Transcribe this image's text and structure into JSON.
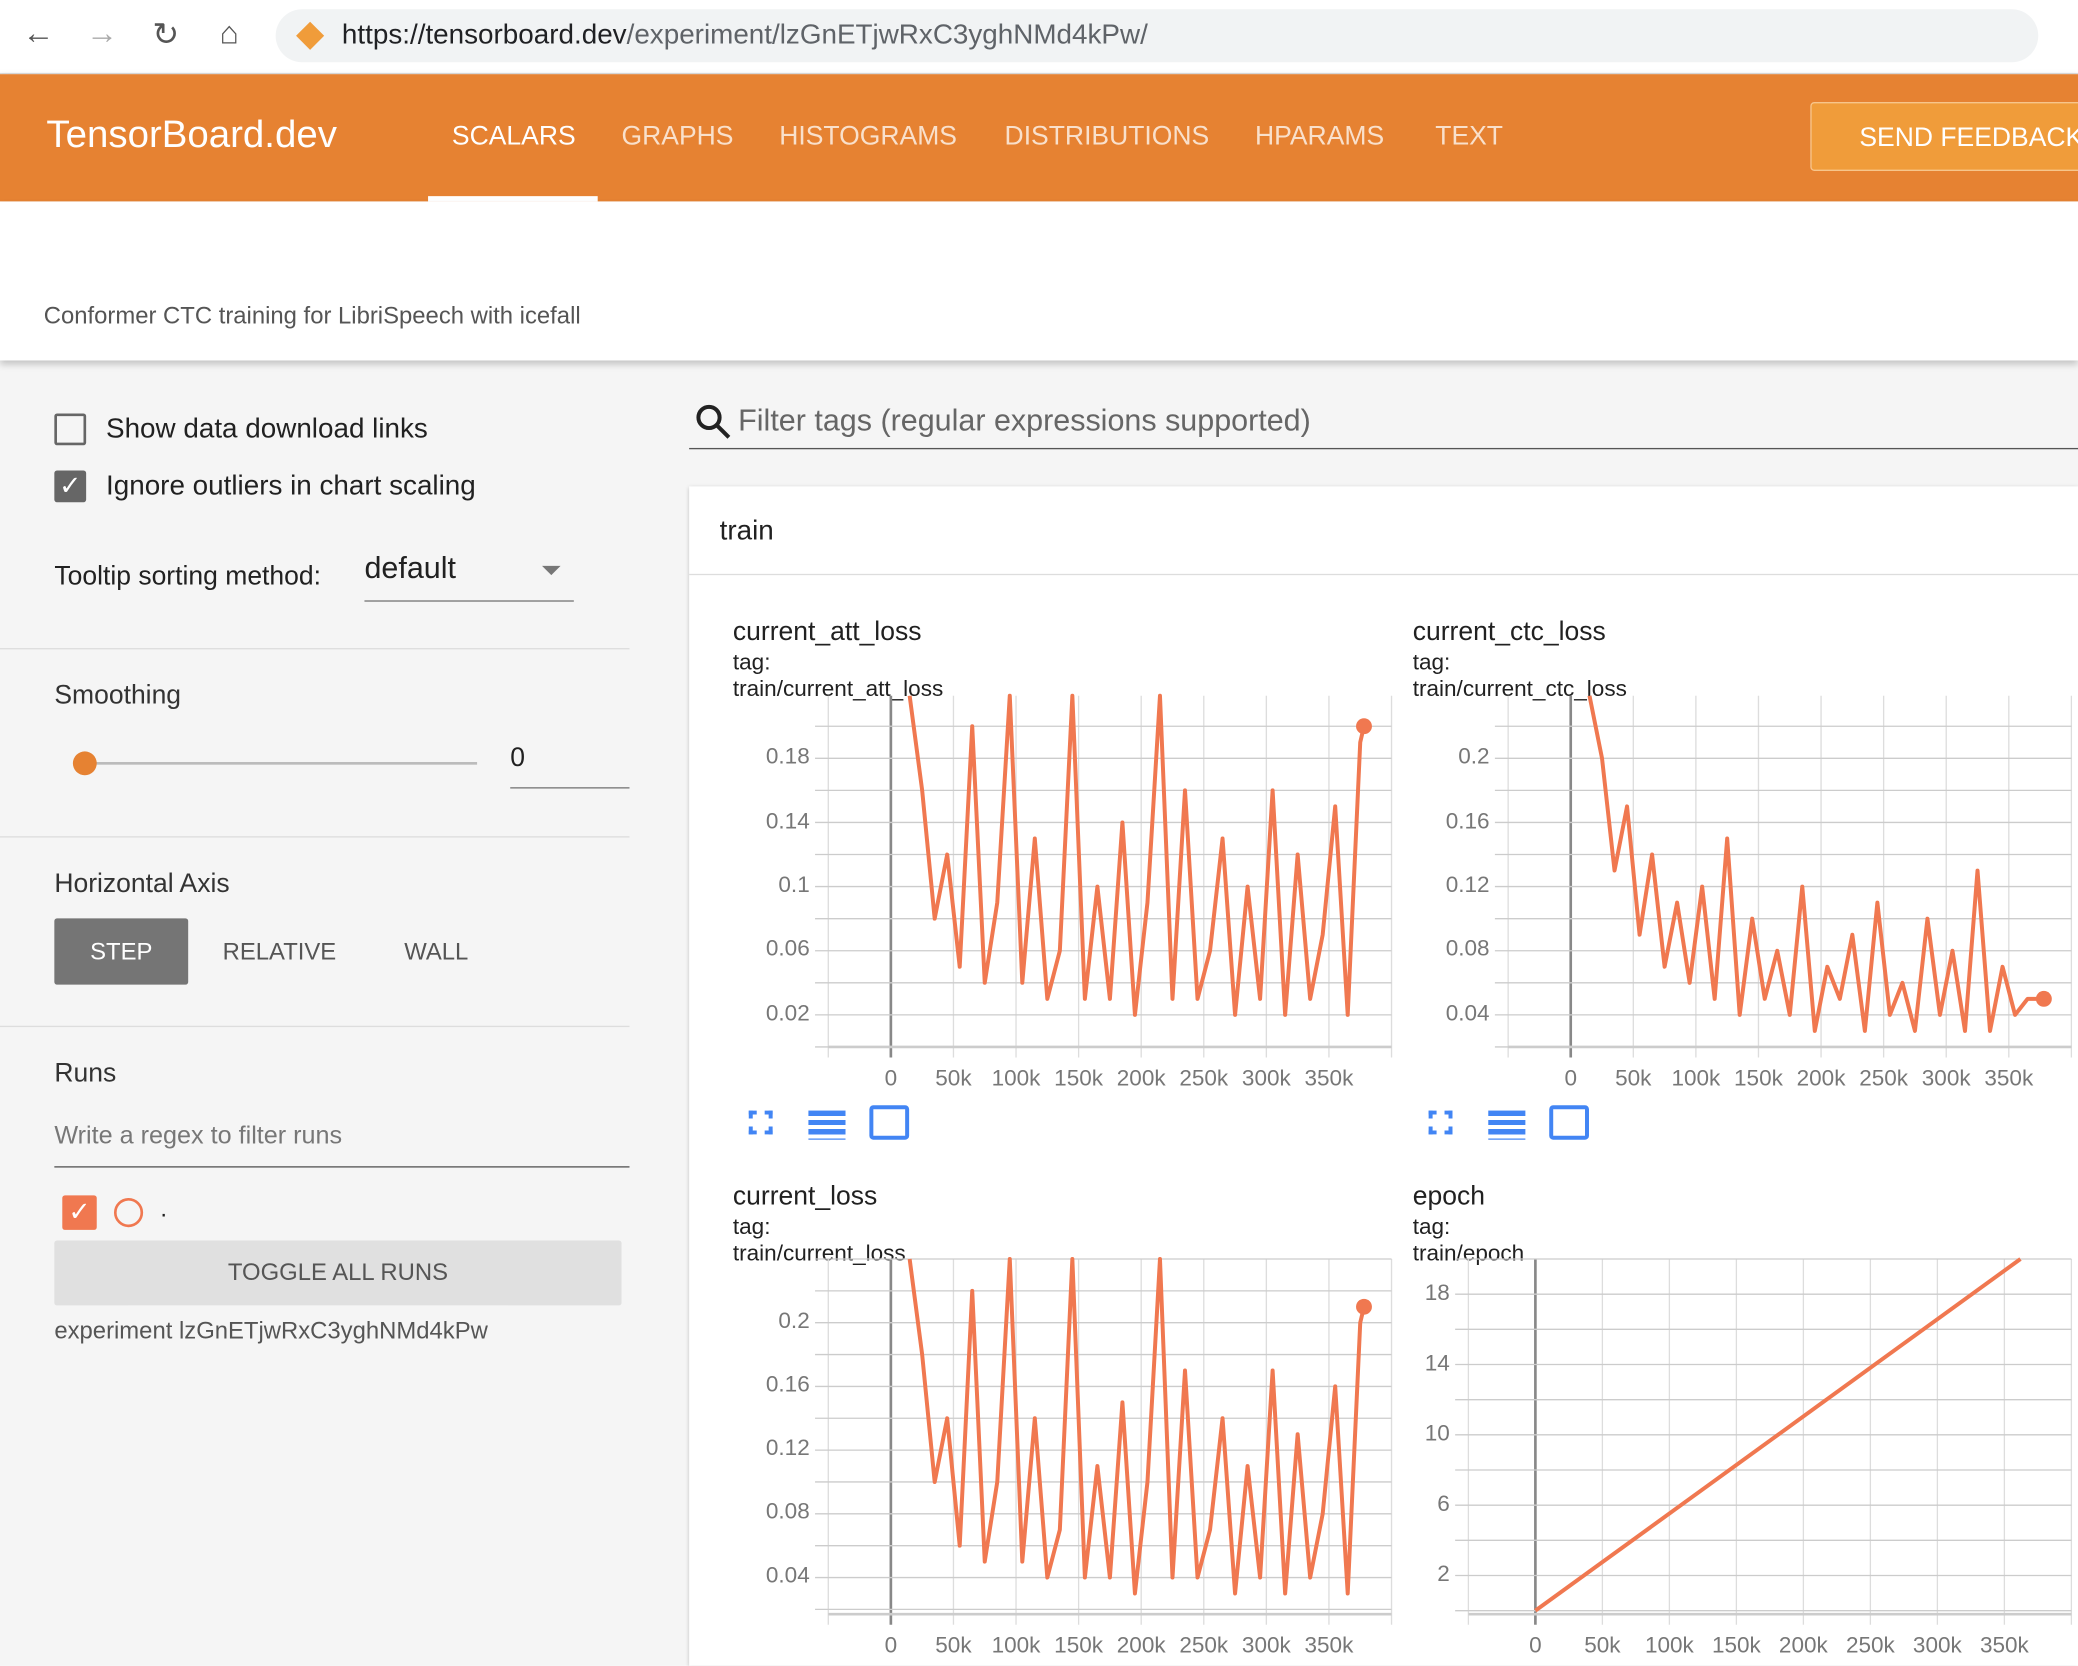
{
  "browser": {
    "url_host": "https://tensorboard.dev",
    "url_path": "/experiment/lzGnETjwRxC3yghNMd4kPw/"
  },
  "header": {
    "logo": "TensorBoard.dev",
    "tabs": [
      {
        "label": "SCALARS",
        "active": true
      },
      {
        "label": "GRAPHS"
      },
      {
        "label": "HISTOGRAMS"
      },
      {
        "label": "DISTRIBUTIONS"
      },
      {
        "label": "HPARAMS"
      },
      {
        "label": "TEXT"
      }
    ],
    "feedback": "SEND FEEDBACK",
    "accent": "#e68232"
  },
  "description": "Conformer CTC training for LibriSpeech with icefall",
  "sidebar": {
    "show_download": {
      "label": "Show data download links",
      "checked": false
    },
    "ignore_outliers": {
      "label": "Ignore outliers in chart scaling",
      "checked": true
    },
    "tooltip_label": "Tooltip sorting method:",
    "tooltip_value": "default",
    "smoothing_label": "Smoothing",
    "smoothing_value": "0",
    "axis_label": "Horizontal Axis",
    "axis_options": [
      "STEP",
      "RELATIVE",
      "WALL"
    ],
    "axis_selected": "STEP",
    "runs_label": "Runs",
    "runs_placeholder": "Write a regex to filter runs",
    "run_name": ".",
    "toggle_all": "TOGGLE ALL RUNS",
    "experiment": "experiment lzGnETjwRxC3yghNMd4kPw"
  },
  "filter_placeholder": "Filter tags (regular expressions supported)",
  "group": "train",
  "series_color": "#f07850",
  "chart_data": [
    {
      "type": "line",
      "title": "current_att_loss",
      "tag": "tag: train/current_att_loss",
      "xlim": [
        -50000,
        400000
      ],
      "ylim": [
        0,
        0.219
      ],
      "xticks": [
        "0",
        "50k",
        "100k",
        "150k",
        "200k",
        "250k",
        "300k",
        "350k"
      ],
      "yticks": [
        "0.02",
        "0.06",
        "0.1",
        "0.14",
        "0.18"
      ],
      "x": [
        15000,
        25000,
        35000,
        45000,
        55000,
        65000,
        75000,
        85000,
        95000,
        105000,
        115000,
        125000,
        135000,
        145000,
        155000,
        165000,
        175000,
        185000,
        195000,
        205000,
        215000,
        225000,
        235000,
        245000,
        255000,
        265000,
        275000,
        285000,
        295000,
        305000,
        315000,
        325000,
        335000,
        345000,
        355000,
        365000,
        375000,
        378000
      ],
      "y": [
        0.22,
        0.16,
        0.08,
        0.12,
        0.05,
        0.2,
        0.04,
        0.09,
        0.22,
        0.04,
        0.13,
        0.03,
        0.06,
        0.22,
        0.03,
        0.1,
        0.03,
        0.14,
        0.02,
        0.09,
        0.22,
        0.03,
        0.16,
        0.03,
        0.06,
        0.13,
        0.02,
        0.1,
        0.03,
        0.16,
        0.02,
        0.12,
        0.03,
        0.07,
        0.15,
        0.02,
        0.19,
        0.2
      ]
    },
    {
      "type": "line",
      "title": "current_ctc_loss",
      "tag": "tag: train/current_ctc_loss",
      "xlim": [
        -50000,
        400000
      ],
      "ylim": [
        0.02,
        0.239
      ],
      "xticks": [
        "0",
        "50k",
        "100k",
        "150k",
        "200k",
        "250k",
        "300k",
        "350k"
      ],
      "yticks": [
        "0.04",
        "0.08",
        "0.12",
        "0.16",
        "0.2"
      ],
      "x": [
        15000,
        25000,
        35000,
        45000,
        55000,
        65000,
        75000,
        85000,
        95000,
        105000,
        115000,
        125000,
        135000,
        145000,
        155000,
        165000,
        175000,
        185000,
        195000,
        205000,
        215000,
        225000,
        235000,
        245000,
        255000,
        265000,
        275000,
        285000,
        295000,
        305000,
        315000,
        325000,
        335000,
        345000,
        355000,
        365000,
        375000,
        378000
      ],
      "y": [
        0.24,
        0.2,
        0.13,
        0.17,
        0.09,
        0.14,
        0.07,
        0.11,
        0.06,
        0.12,
        0.05,
        0.15,
        0.04,
        0.1,
        0.05,
        0.08,
        0.04,
        0.12,
        0.03,
        0.07,
        0.05,
        0.09,
        0.03,
        0.11,
        0.04,
        0.06,
        0.03,
        0.1,
        0.04,
        0.08,
        0.03,
        0.13,
        0.03,
        0.07,
        0.04,
        0.05,
        0.05,
        0.05
      ]
    },
    {
      "type": "line",
      "title": "current_loss",
      "tag": "tag: train/current_loss",
      "xlim": [
        -50000,
        400000
      ],
      "ylim": [
        0.017,
        0.24
      ],
      "xticks": [
        "0",
        "50k",
        "100k",
        "150k",
        "200k",
        "250k",
        "300k",
        "350k"
      ],
      "yticks": [
        "0.04",
        "0.08",
        "0.12",
        "0.16",
        "0.2"
      ],
      "x": [
        15000,
        25000,
        35000,
        45000,
        55000,
        65000,
        75000,
        85000,
        95000,
        105000,
        115000,
        125000,
        135000,
        145000,
        155000,
        165000,
        175000,
        185000,
        195000,
        205000,
        215000,
        225000,
        235000,
        245000,
        255000,
        265000,
        275000,
        285000,
        295000,
        305000,
        315000,
        325000,
        335000,
        345000,
        355000,
        365000,
        375000,
        378000
      ],
      "y": [
        0.24,
        0.18,
        0.1,
        0.14,
        0.06,
        0.22,
        0.05,
        0.1,
        0.24,
        0.05,
        0.14,
        0.04,
        0.07,
        0.24,
        0.04,
        0.11,
        0.04,
        0.15,
        0.03,
        0.1,
        0.24,
        0.04,
        0.17,
        0.04,
        0.07,
        0.14,
        0.03,
        0.11,
        0.04,
        0.17,
        0.03,
        0.13,
        0.04,
        0.08,
        0.16,
        0.03,
        0.2,
        0.21
      ]
    },
    {
      "type": "line",
      "title": "epoch",
      "tag": "tag: train/epoch",
      "xlim": [
        -50000,
        400000
      ],
      "ylim": [
        -0.2,
        20
      ],
      "xticks": [
        "0",
        "50k",
        "100k",
        "150k",
        "200k",
        "250k",
        "300k",
        "350k"
      ],
      "yticks": [
        "2",
        "6",
        "10",
        "14",
        "18"
      ],
      "x": [
        0,
        362000
      ],
      "y": [
        0,
        20
      ]
    }
  ]
}
